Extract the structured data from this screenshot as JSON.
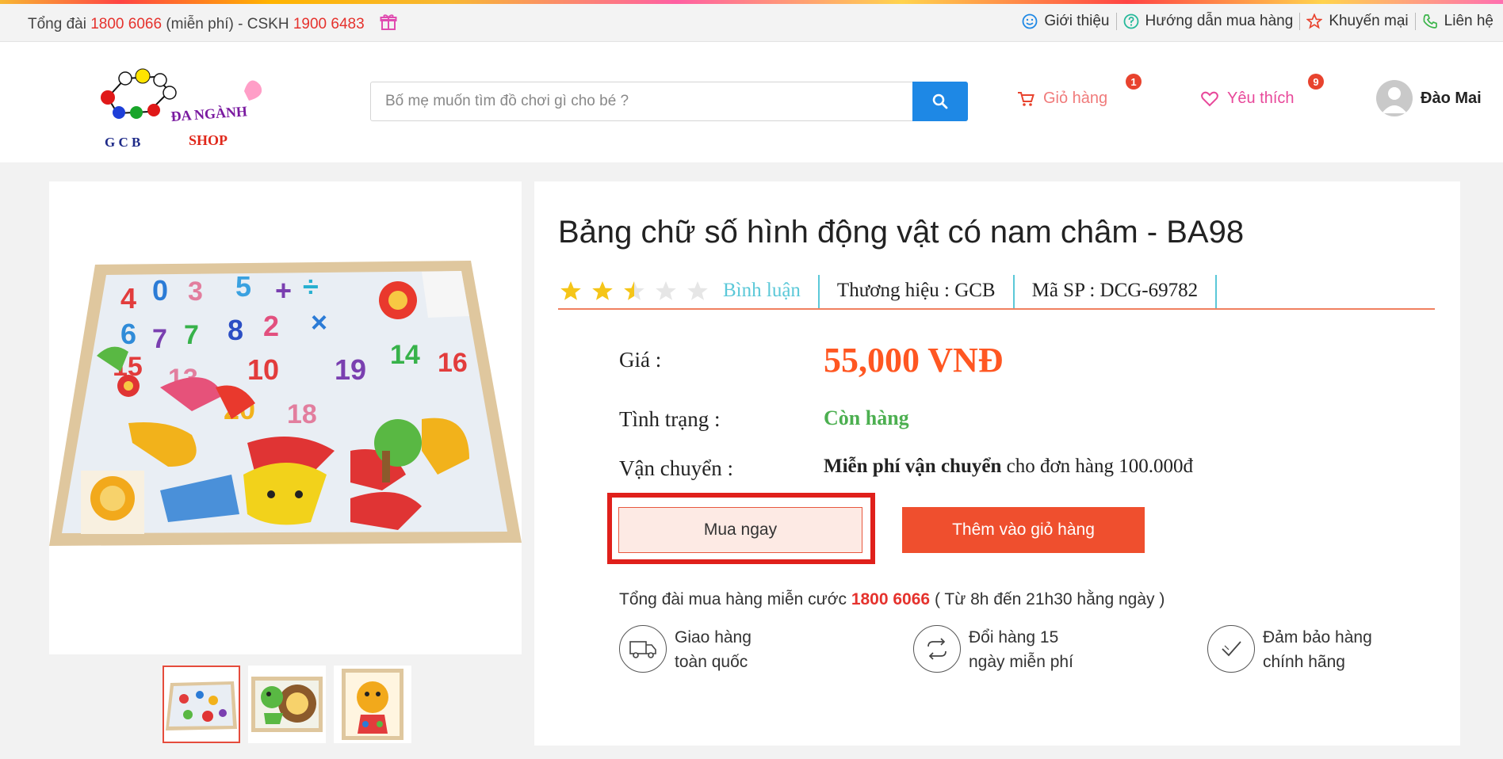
{
  "topbar": {
    "hotline_prefix": "Tổng đài",
    "hotline_number": "1800 6066",
    "hotline_mid": "(miễn phí) - CSKH",
    "cskh_number": "1900 6483",
    "links": [
      {
        "label": "Giới thiệu",
        "icon": "smile-icon"
      },
      {
        "label": "Hướng dẫn mua hàng",
        "icon": "question-icon"
      },
      {
        "label": "Khuyến mại",
        "icon": "star-icon"
      },
      {
        "label": "Liên hệ",
        "icon": "phone-icon"
      }
    ]
  },
  "header": {
    "logo": {
      "line1": "ĐA NGÀNH",
      "line2": "SHOP",
      "line3": "G C B"
    },
    "search_placeholder": "Bố mẹ muốn tìm đồ chơi gì cho bé ?",
    "cart_label": "Giỏ hàng",
    "cart_count": "1",
    "wishlist_label": "Yêu thích",
    "wishlist_count": "9",
    "user_name": "Đào Mai"
  },
  "product": {
    "title": "Bảng chữ số hình động vật có nam châm - BA98",
    "rating": 2.5,
    "review_label": "Bình luận",
    "brand": "Thương hiệu : GCB",
    "sku": "Mã SP : DCG-69782",
    "price_label": "Giá :",
    "price": "55,000 VNĐ",
    "status_label": "Tình trạng :",
    "status": "Còn hàng",
    "shipping_label": "Vận chuyển :",
    "shipping_bold": "Miễn phí vận chuyển",
    "shipping_rest": " cho đơn hàng 100.000đ",
    "buy_now": "Mua ngay",
    "add_to_cart": "Thêm vào giỏ hàng",
    "hotline_text": "Tổng đài mua hàng miễn cước",
    "hotline_number": "1800 6066",
    "hotline_hours": "( Từ 8h đến 21h30 hằng ngày )",
    "features": [
      {
        "line1": "Giao hàng",
        "line2": "toàn quốc",
        "icon": "truck-icon"
      },
      {
        "line1": "Đổi hàng 15",
        "line2": "ngày miễn phí",
        "icon": "exchange-icon"
      },
      {
        "line1": "Đảm bảo hàng",
        "line2": "chính hãng",
        "icon": "check-icon"
      }
    ]
  },
  "colors": {
    "accent": "#1e88e5",
    "price": "#ff5722",
    "in_stock": "#4caf50",
    "cta": "#ef4f2e",
    "highlight": "#e0201b"
  }
}
